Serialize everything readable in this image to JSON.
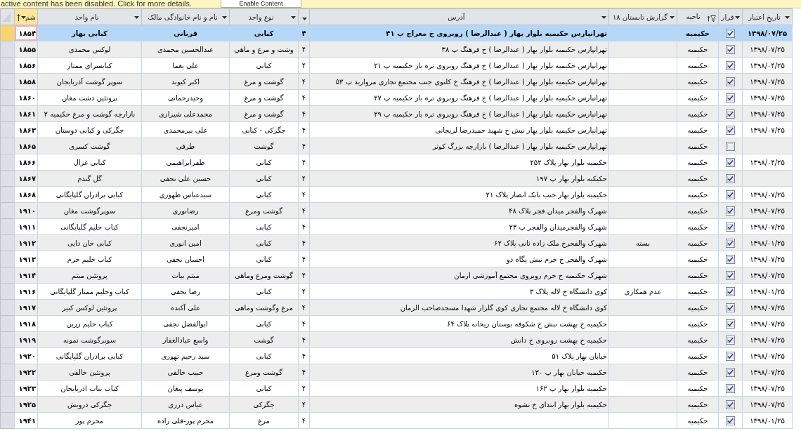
{
  "message_bar": {
    "text": "active content has been disabled. Click for more details.",
    "button": "Enable Content"
  },
  "table": {
    "columns": [
      {
        "label": "تاریخ اعتبار",
        "kind": "date",
        "selected": false,
        "sorted": false,
        "filtered": false
      },
      {
        "label": "قرار",
        "kind": "checkbox",
        "selected": false,
        "sorted": false,
        "filtered": false
      },
      {
        "label": "ناحیه",
        "kind": "text",
        "selected": false,
        "sorted": false,
        "filtered": true
      },
      {
        "label": "گزارش تابستان ۱۸",
        "kind": "text",
        "selected": false,
        "sorted": false,
        "filtered": false
      },
      {
        "label": "آدرس",
        "kind": "address",
        "selected": false,
        "sorted": false,
        "filtered": false
      },
      {
        "kind": "text",
        "selected": false,
        "sorted": false,
        "filtered": false
      },
      {
        "label": "نوع واحد",
        "kind": "text",
        "selected": false,
        "sorted": false,
        "filtered": false
      },
      {
        "label": "نام و نام خانوادگی مالک",
        "kind": "text",
        "selected": false,
        "sorted": false,
        "filtered": false
      },
      {
        "label": "نام واحد",
        "kind": "text",
        "selected": false,
        "sorted": false,
        "filtered": false
      },
      {
        "label": "شم",
        "kind": "number",
        "selected": true,
        "sorted": true,
        "filtered": false
      }
    ],
    "rows": [
      {
        "selected": true,
        "date": "۱۳۹۸/۰۷/۲۵",
        "checked": true,
        "district": "حکیمیه",
        "address": "تهرانپارس حکیمیه بلوار بهار ( عبدالرضا ) روبروی خ معراج پ ۴۱",
        "column_6": "۴",
        "unit_type": "کبابی",
        "owner_name": "قربانی",
        "unit_name": "کبابی بهار",
        "column_10": "۱۸۵۴"
      },
      {
        "selected": false,
        "date": "۱۳۹۸/۰۷/۲۵",
        "checked": true,
        "district": "حکیمیه",
        "address": "تهرانپارس حکیمیه بلوار بهار ( عبدالرضا ) خ فرهنگ پ ۳۸",
        "column_6": "۴",
        "unit_type": "وشت و مرغ و ماهی",
        "owner_name": "عبدالحسین محمدی",
        "unit_name": "لوکس محمدی",
        "column_10": "۱۸۵۵"
      },
      {
        "selected": false,
        "date": "۱۳۹۸/۰۴/۲۵",
        "checked": true,
        "district": "حکیمیه",
        "address": "تهرانپارس حکیمیه بلوار بهار ( عبدالرضا ) خ فرهنگ روبروی تره بار حکیمیه پ ۲۱",
        "column_6": "۴",
        "unit_type": "کبابی",
        "owner_name": "علی یغما",
        "unit_name": "کبابسرای ممتاز",
        "column_10": "۱۸۵۶"
      },
      {
        "selected": false,
        "date": "۱۳۹۸/۰۷/۲۵",
        "checked": true,
        "district": "حکیمیه",
        "address": "تهرانپارس حکیمیه بلوار بهار ( عبدالرضا ) خ فرهنگ خ کلتوی جنب مجتمع تجاری مروارید پ ۵۳",
        "column_6": "۴",
        "unit_type": "گوشت و مرغ",
        "owner_name": "اکبر کیوند",
        "unit_name": "سوپر گوشت آذربایجان",
        "column_10": "۱۸۵۸"
      },
      {
        "selected": false,
        "date": "۱۳۹۸/۰۷/۲۵",
        "checked": true,
        "district": "حکیمیه",
        "address": "تهرانپارس حکیمیه بلوار بهار ( عبدالرضا ) خ فرهنگ روبروی تره بار حکیمیه پ ۲۷",
        "column_6": "۴",
        "unit_type": "گوشت و مرغ",
        "owner_name": "وحیدرحمانی",
        "unit_name": "پروتئین دشت مغان",
        "column_10": "۱۸۶۰"
      },
      {
        "selected": false,
        "date": "۱۳۹۸/۰۷/۲۵",
        "checked": true,
        "district": "حکیمیه",
        "address": "تهرانپارس حکیمیه بلوار بهار ( عبدالرضا ) خ فرهنگ روبروی تره بار حکیمیه پ ۲۹",
        "column_6": "۴",
        "unit_type": "گوشت و مرغ",
        "owner_name": "محمدعلی شیرازی",
        "unit_name": "بازارچه گوشت و مرغ حکیمیه ۲",
        "column_10": "۱۸۶۱"
      },
      {
        "selected": false,
        "date": "۱۳۹۸/۰۷/۲۵",
        "checked": true,
        "district": "حکیمیه",
        "address": "تهرانپارس حکیمیه بلوار بهار نبش خ شهید حمیدرضا لریجانی",
        "column_6": "۴",
        "unit_type": "جگرکی - کبابی",
        "owner_name": "علی بیرمحمدی",
        "unit_name": "جگرکی و کبابی دوستان",
        "column_10": "۱۸۶۳"
      },
      {
        "selected": false,
        "checked": false,
        "district": "حکیمیه",
        "address": "تهرانپارس حکیمیه بلوار بهار ( عبدالرضا ) بازارچه بزرگ کوثر",
        "column_6": "۴",
        "unit_type": "گوشت",
        "owner_name": "طرقی",
        "unit_name": "گوشت کسری",
        "column_10": "۱۸۶۵"
      },
      {
        "selected": false,
        "date": "۱۳۹۸/۰۴/۲۵",
        "checked": true,
        "district": "حکیمیه",
        "address": "حکیمیه بلوار بهار پلاک ۲۵۲",
        "column_6": "۴",
        "unit_type": "کبابی",
        "owner_name": "ظفرابراهیمی",
        "unit_name": "کبابی غزال",
        "column_10": "۱۸۶۶"
      },
      {
        "selected": false,
        "checked": true,
        "district": "حکیمیه",
        "address": "حکیکیه بلوار بهار پ ۱۹۷",
        "column_6": "۴",
        "unit_type": "کبابی",
        "owner_name": "حسین علی نجفی",
        "unit_name": "گل گندم",
        "column_10": "۱۸۶۷"
      },
      {
        "selected": false,
        "date": "۱۳۹۸/۰۷/۲۵",
        "checked": true,
        "district": "حکیمیه",
        "address": "حکیمیه بلوار بهار جنب بانک انصار پلاک ۲۱",
        "column_6": "۴",
        "unit_type": "کبابی",
        "owner_name": "سیدعباس طهوری",
        "unit_name": "کبابی برادران گلپایگانی",
        "column_10": "۱۸۶۸"
      },
      {
        "selected": false,
        "date": "۱۳۹۸/۰۷/۲۵",
        "checked": true,
        "district": "حکیمیه",
        "address": "شهرک والفجر میدان فجر پلاک ۴۸",
        "column_6": "۴",
        "unit_type": "گوشت ومرغ",
        "owner_name": "رضانوری",
        "unit_name": "سوپرگوشت مغان",
        "column_10": "۱۹۱۰"
      },
      {
        "selected": false,
        "date": "۱۳۹۸/۰۷/۲۵",
        "checked": true,
        "district": "حکیمیه",
        "address": "شهرک والفجرمیدان والفجر پ ۲۳",
        "column_6": "۴",
        "unit_type": "کبابی",
        "owner_name": "امیرنجفی",
        "unit_name": "کباب حلیم گلپایگانی",
        "column_10": "۱۹۱۱"
      },
      {
        "selected": false,
        "date": "۱۳۹۸/۰۱/۲۵",
        "checked": true,
        "district": "حکیمیه",
        "summer_report": "بسته",
        "address": "شهرک والفجرخ ملک زاده ثانی پلاک ۶۲",
        "column_6": "۴",
        "unit_type": "کبابی",
        "owner_name": "امین انوری",
        "unit_name": "کبابی خان دایی",
        "column_10": "۱۹۱۲"
      },
      {
        "selected": false,
        "date": "۱۳۹۸/۰۷/۲۵",
        "checked": true,
        "district": "حکیمیه",
        "address": "شهرک والفجر خ خرم نبش پگاه دو",
        "column_6": "۴",
        "unit_type": "کبابی",
        "owner_name": "احسان نجفی",
        "unit_name": "کباب حلیم خرم",
        "column_10": "۱۹۱۳"
      },
      {
        "selected": false,
        "date": "۱۳۹۸/۰۷/۲۵",
        "checked": true,
        "district": "حکیمیه",
        "address": "شهرک حکیمیه خ خرم روبروی مجتمع آموزشی ارمان",
        "column_6": "۴",
        "unit_type": "گوشت ومرغ وماهی",
        "owner_name": "میثم بیات",
        "unit_name": "پروتئین میثم",
        "column_10": "۱۹۱۴"
      },
      {
        "selected": false,
        "date": "۱۳۹۸/۰۱/۲۵",
        "checked": true,
        "district": "حکیمیه",
        "summer_report": "عدم همکاری",
        "address": "کوی دانشگاه خ لاله پلاک ۳",
        "column_6": "۴",
        "unit_type": "کبابی",
        "owner_name": "رضا نجفی",
        "unit_name": "کباب وحلیم ممتاز گلپایگانی",
        "column_10": "۱۹۱۶"
      },
      {
        "selected": false,
        "date": "۱۳۹۸/۰۷/۲۵",
        "checked": true,
        "district": "حکیمیه",
        "address": "کوی دانشگاه خ لاله مجتمع تجاری کوی گلزار شهدا مسجدصاحب الزمان",
        "column_6": "۴",
        "unit_type": "مرغ وگوشت وماهی",
        "owner_name": "علی آکنده",
        "unit_name": "پروتئین لوکس کبیر",
        "column_10": "۱۹۱۷"
      },
      {
        "selected": false,
        "date": "۱۳۹۸/۰۷/۲۵",
        "checked": true,
        "district": "حکیمیه",
        "address": "حکیمیه خ بهشت نبش خ شکوفه بوستان ریحانه پلاک ۶۴",
        "column_6": "۴",
        "unit_type": "کبابی",
        "owner_name": "ابوالفضل نجفی",
        "unit_name": "کباب حلیم زرین",
        "column_10": "۱۹۱۸"
      },
      {
        "selected": false,
        "date": "۱۳۹۸/۰۷/۲۵",
        "checked": true,
        "district": "حکیمیه",
        "address": "حکیمیه خ بهشت روبروی خ دانش",
        "column_6": "۴",
        "unit_type": "گوشت",
        "owner_name": "واسع عبادالغفار",
        "unit_name": "سوپرگوشت نمونه",
        "column_10": "۱۹۱۹"
      },
      {
        "selected": false,
        "date": "۱۳۹۸/۰۷/۲۵",
        "checked": true,
        "district": "حکیمیه",
        "address": "خیابان بهار پلاک ۵۱",
        "column_6": "۴",
        "unit_type": "کبابی",
        "owner_name": "سید رحیم تهوری",
        "unit_name": "کبابی برادران گلپایگانی",
        "column_10": "۱۹۲۰"
      },
      {
        "selected": false,
        "date": "۱۳۹۸/۰۷/۲۵",
        "checked": true,
        "district": "حکیمیه",
        "address": "حکیمیه خیابان بهار پ ۱۳۰",
        "column_6": "۴",
        "unit_type": "گوشت ومرغ",
        "owner_name": "حبیب خالقی",
        "unit_name": "پروتئین خالقی",
        "column_10": "۱۹۲۲"
      },
      {
        "selected": false,
        "date": "۱۳۹۸/۰۷/۲۵",
        "checked": true,
        "district": "حکیمیه",
        "address": "حکیمیه بلوار بهار پ ۱۶۲",
        "column_6": "۴",
        "unit_type": "کبابی",
        "owner_name": "یوسف پیغان",
        "unit_name": "کباب بناب اذربایجان",
        "column_10": "۱۹۲۳"
      },
      {
        "selected": false,
        "date": "۱۳۹۸/۰۷/۲۵",
        "checked": true,
        "district": "حکیمیه",
        "address": "حکیمیه بلوار بهار ابتدای خ نشوه",
        "column_6": "۴",
        "unit_type": "جگرکی",
        "owner_name": "عباس درزی",
        "unit_name": "جگرکی درویش",
        "column_10": "۱۹۲۵"
      },
      {
        "selected": false,
        "date": "۱۳۹۸/۰۱/۲۵",
        "checked": true,
        "district": "حکیمیه",
        "column_6": "۴",
        "unit_type": "مرغ",
        "owner_name": "محرم پور-قلی زاده",
        "unit_name": "محرم پور",
        "column_10": "۱۹۴۱"
      }
    ]
  }
}
